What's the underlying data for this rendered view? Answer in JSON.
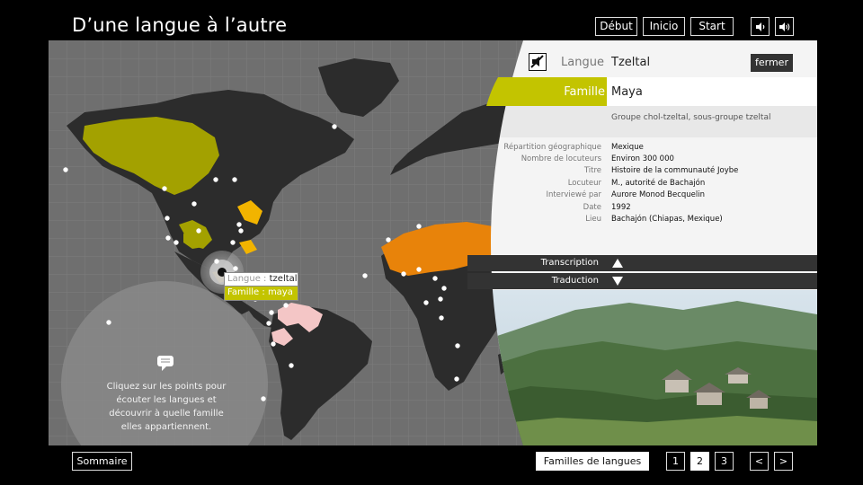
{
  "app": {
    "title": "D’une langue à l’autre"
  },
  "header": {
    "buttons": [
      {
        "label": "Début"
      },
      {
        "label": "Inicio"
      },
      {
        "label": "Start"
      }
    ],
    "icons": [
      "volume-low-icon",
      "volume-high-icon"
    ]
  },
  "panel": {
    "langue_label": "Langue",
    "langue_value": "Tzeltal",
    "close_label": "fermer",
    "famille_label": "Famille",
    "famille_value": "Maya",
    "subgroup": "Groupe chol-tzeltal, sous-groupe tzeltal",
    "info": [
      {
        "key": "Répartition géographique",
        "value": "Mexique"
      },
      {
        "key": "Nombre de locuteurs",
        "value": "Environ 300 000"
      },
      {
        "key": "Titre",
        "value": "Histoire de la communauté Joybe"
      },
      {
        "key": "Locuteur",
        "value": "M., autorité de Bachajón"
      },
      {
        "key": "Interviewé par",
        "value": "Aurore Monod Becquelin"
      },
      {
        "key": "Date",
        "value": "1992"
      },
      {
        "key": "Lieu",
        "value": "Bachajón (Chiapas, Mexique)"
      }
    ],
    "transcription_label": "Transcription",
    "traduction_label": "Traduction"
  },
  "map": {
    "tooltip": {
      "langue_label": "Langue :",
      "langue_value": "tzeltal",
      "famille_label": "Famille :",
      "famille_value": "maya"
    },
    "hint": "Cliquez sur les points pour écouter les langues et découvrir à quelle famille elles appartiennent."
  },
  "footer": {
    "sommaire_label": "Sommaire",
    "familles_label": "Familles de langues",
    "pages": [
      "1",
      "2",
      "3"
    ],
    "active_page": "2",
    "prev_label": "<",
    "next_label": ">"
  },
  "colors": {
    "maya": "#c3c400",
    "yellow": "#f2b400",
    "orange": "#e8830a",
    "pink": "#f4c6c6",
    "land": "#2c2c2c",
    "ocean": "#6f6f6f"
  }
}
